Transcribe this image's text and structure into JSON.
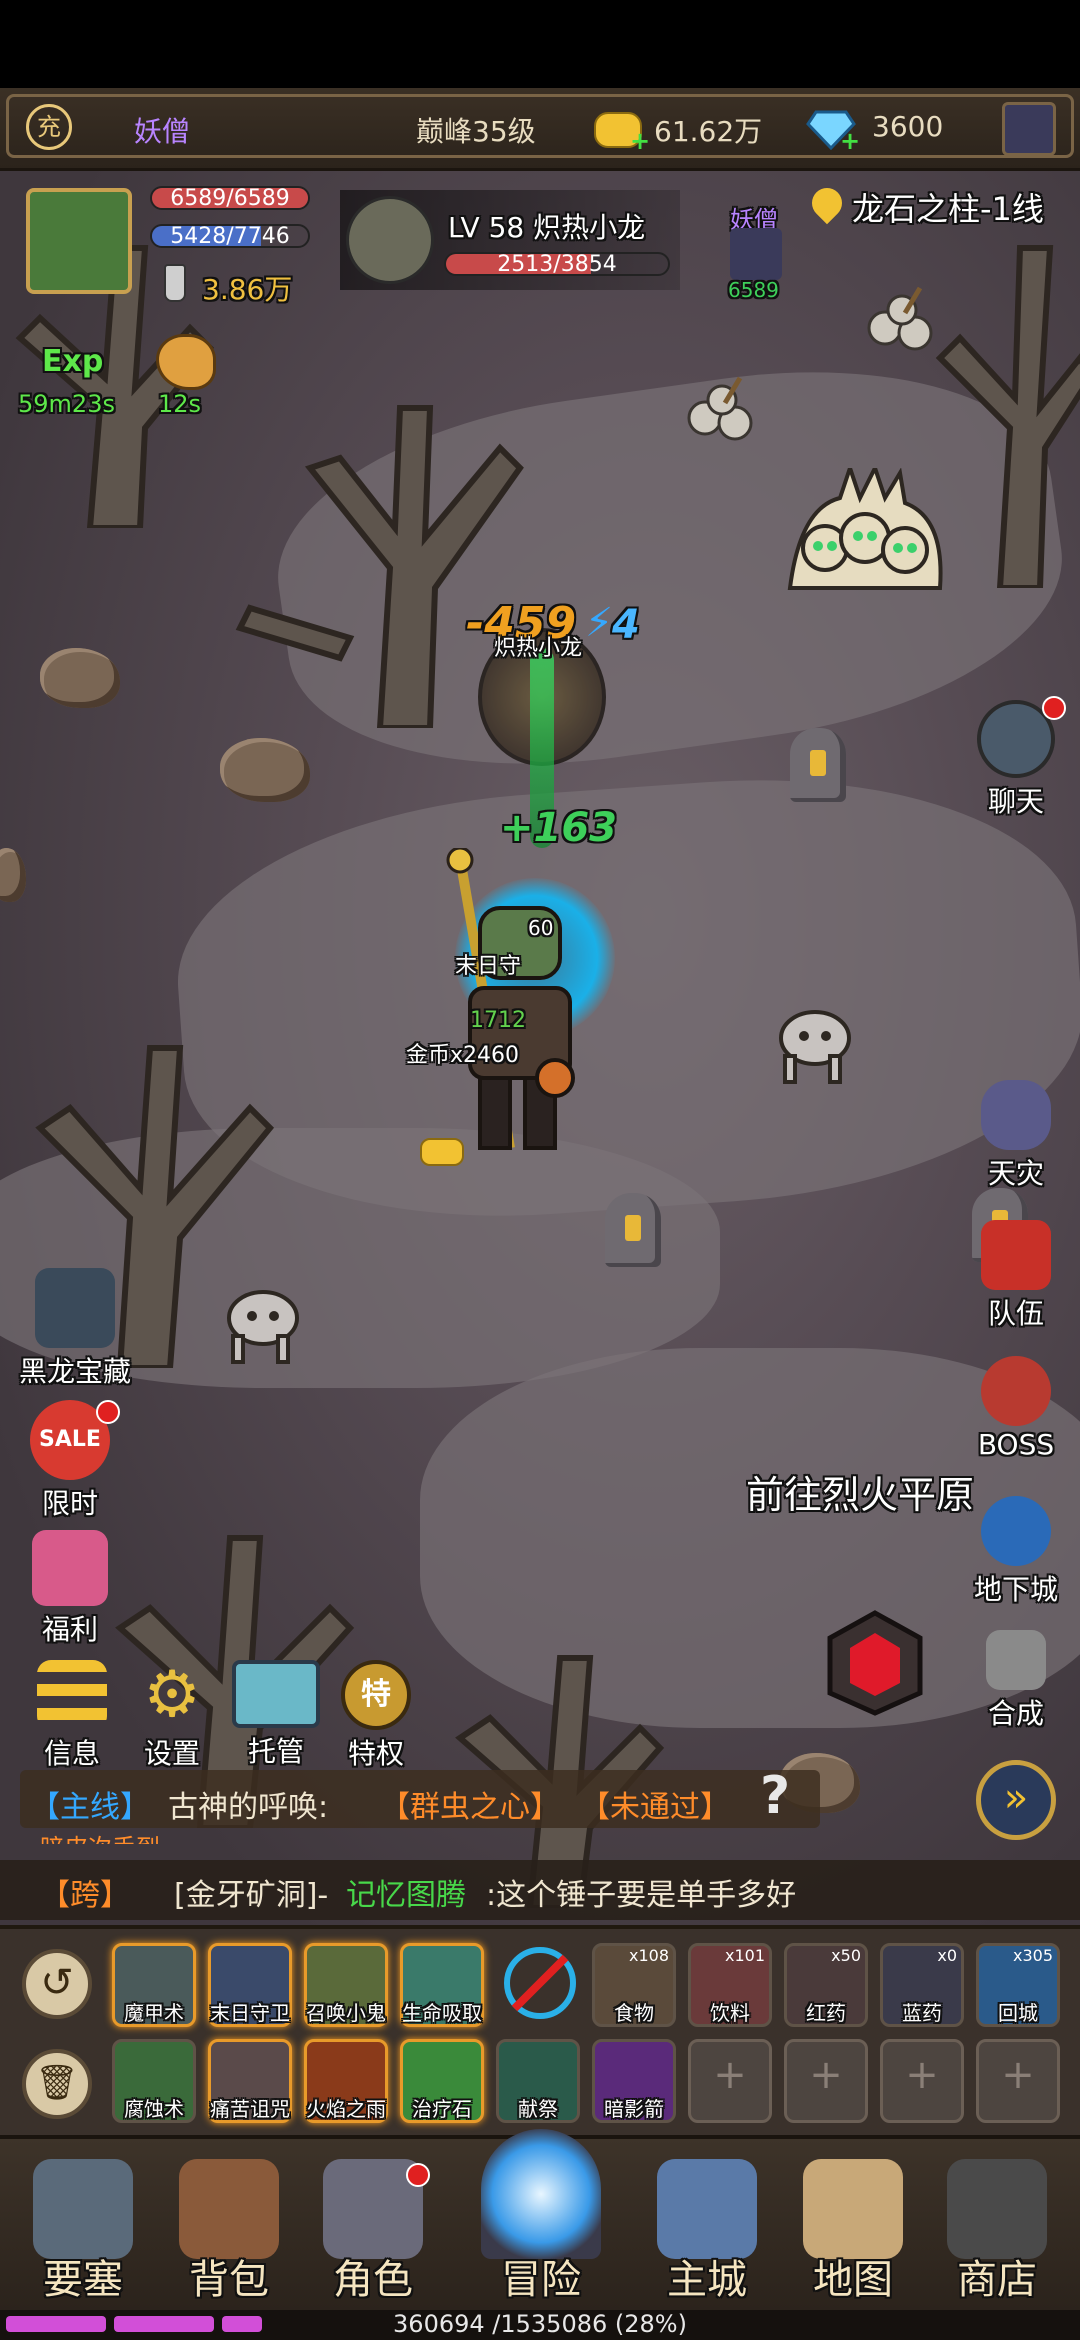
{
  "topbar": {
    "charge_icon_label": "充",
    "player_name": "妖僧",
    "peak_level": "巅峰35级",
    "gold": "61.62万",
    "diamonds": "3600"
  },
  "player": {
    "hp": "6589/6589",
    "mp": "5428/7746",
    "power": "3.86万"
  },
  "target": {
    "title": "LV 58 炽热小龙",
    "hp": "2513/3854",
    "hp_fraction": 0.652
  },
  "party": {
    "name": "妖僧",
    "hp": "6589"
  },
  "location": "龙石之柱-1线",
  "buffs": [
    {
      "label": "Exp",
      "timer": "59m23s"
    },
    {
      "label": "",
      "timer": "12s"
    }
  ],
  "battle": {
    "damage": "-459",
    "crit": "4",
    "enemy_label": "炽热小龙",
    "heal": "+163",
    "pet_level": "60",
    "pet_name": "末日守",
    "player_small": "1712",
    "loot": "金币x2460"
  },
  "right_menu": [
    {
      "label": "聊天"
    },
    {
      "label": "天灾"
    },
    {
      "label": "队伍"
    },
    {
      "label": "BOSS"
    },
    {
      "label": "地下城"
    },
    {
      "label": "合成"
    }
  ],
  "left_menu": [
    {
      "label": "黑龙宝藏"
    },
    {
      "label": "限时",
      "icon_text": "SALE"
    },
    {
      "label": "福利"
    }
  ],
  "tools": [
    {
      "label": "信息"
    },
    {
      "label": "设置"
    },
    {
      "label": "托管"
    },
    {
      "label": "特权",
      "icon_text": "特"
    }
  ],
  "portal_hint": "前往烈火平原",
  "quest": {
    "tag": "【主线】",
    "name": "古神的呼唤:",
    "target": "【群虫之心】",
    "status": "【未通过】",
    "sub": "暗皮次手到"
  },
  "chat": {
    "channel": "【跨】",
    "place": "[金牙矿洞]-",
    "user": "记忆图腾",
    "message": ":这个锤子要是单手多好"
  },
  "skills_row1": [
    {
      "name": "魔甲术"
    },
    {
      "name": "末日守卫"
    },
    {
      "name": "召唤小鬼"
    },
    {
      "name": "生命吸取"
    }
  ],
  "items_row1": [
    {
      "name": "食物",
      "count": "x108"
    },
    {
      "name": "饮料",
      "count": "x101"
    },
    {
      "name": "红药",
      "count": "x50"
    },
    {
      "name": "蓝药",
      "count": "x0"
    },
    {
      "name": "回城",
      "count": "x305"
    }
  ],
  "skills_row2": [
    {
      "name": "腐蚀术"
    },
    {
      "name": "痛苦诅咒"
    },
    {
      "name": "火焰之雨"
    },
    {
      "name": "治疗石"
    },
    {
      "name": "献祭"
    },
    {
      "name": "暗影箭"
    }
  ],
  "nav": [
    {
      "label": "要塞"
    },
    {
      "label": "背包"
    },
    {
      "label": "角色"
    },
    {
      "label": "冒险"
    },
    {
      "label": "主城"
    },
    {
      "label": "地图"
    },
    {
      "label": "商店"
    }
  ],
  "xp": {
    "text": "360694 /1535086 (28%)",
    "fraction": 0.28
  },
  "colors": {
    "hp_red": "#c84a4a",
    "mp_blue": "#4a6fc8",
    "quest_orange": "#ff8c2a",
    "chat_green": "#48d84a",
    "xp_purple": "#d24fd8"
  }
}
